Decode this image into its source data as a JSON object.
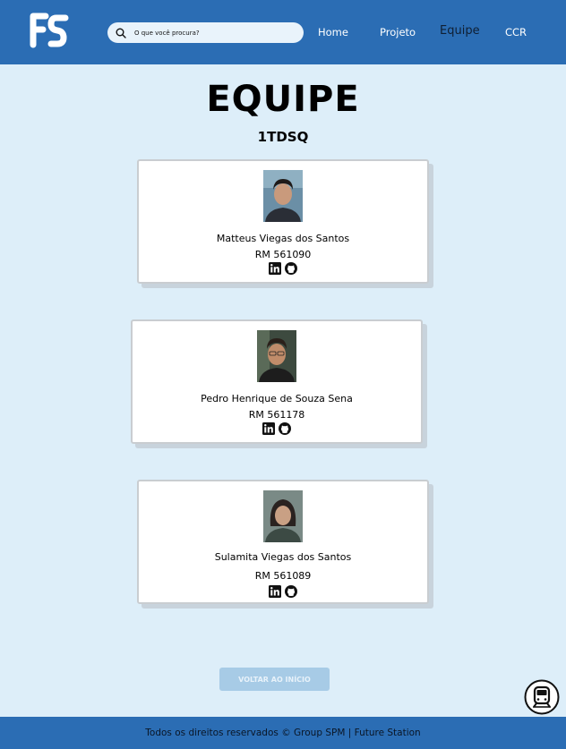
{
  "header": {
    "logo_text": "FS",
    "search": {
      "placeholder": "O que você procura?"
    },
    "nav": [
      {
        "label": "Home"
      },
      {
        "label": "Projeto"
      },
      {
        "label": "Equipe"
      },
      {
        "label": "CCR"
      }
    ]
  },
  "main": {
    "title": "EQUIPE",
    "subtitle": "1TDSQ",
    "members": [
      {
        "name": "Matteus Viegas dos Santos",
        "rm": "RM 561090"
      },
      {
        "name": "Pedro Henrique de Souza Sena",
        "rm": "RM 561178"
      },
      {
        "name": "Sulamita Viegas dos Santos",
        "rm": "RM 561089"
      }
    ],
    "back_button": "VOLTAR AO INÍCIO"
  },
  "footer": {
    "text": "Todos os direitos reservados © Group SPM | Future Station"
  },
  "icons": {
    "search": "search-icon",
    "linkedin": "linkedin-icon",
    "github": "github-icon",
    "train": "train-icon"
  },
  "colors": {
    "header_bg": "#2b6db4",
    "page_bg": "#ddeef9",
    "button_bg": "#a7cbe6"
  }
}
